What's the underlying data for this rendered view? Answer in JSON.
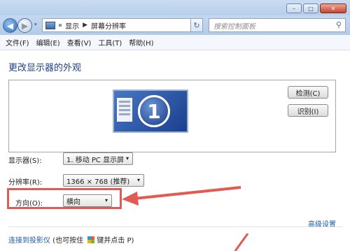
{
  "window": {
    "minimize": "–",
    "maximize": "□",
    "close": "✕"
  },
  "nav": {
    "back_icon": "back-arrow-icon",
    "forward_icon": "forward-arrow-icon",
    "back_glyph": "◀",
    "forward_glyph": "▶",
    "chevrons": "«",
    "breadcrumb": [
      "显示",
      "屏幕分辨率"
    ],
    "separator": "▶",
    "refresh_glyph": "↻",
    "search_placeholder": "搜索控制面板",
    "search_glyph": "⚲",
    "dropdown_glyph": "▾"
  },
  "menu": [
    "文件(F)",
    "编辑(E)",
    "查看(V)",
    "工具(T)",
    "帮助(H)"
  ],
  "main": {
    "title": "更改显示器的外观",
    "monitor_number": "1",
    "detect_button": "检测(C)",
    "identify_button": "识别(I)",
    "display_label": "显示器(S):",
    "display_value": "1. 移动 PC 显示屏",
    "resolution_label": "分辨率(R):",
    "resolution_value": "1366 × 768 (推荐)",
    "orientation_label": "方向(O):",
    "orientation_value": "横向",
    "advanced_link": "高级设置",
    "projector_link": "连接到投影仪",
    "projector_hint_pre": " (也可按住 ",
    "projector_hint_post": "键并点击 P)"
  },
  "colors": {
    "highlight": "#e25a52",
    "link": "#1a5aa8",
    "title": "#1e3f87"
  }
}
